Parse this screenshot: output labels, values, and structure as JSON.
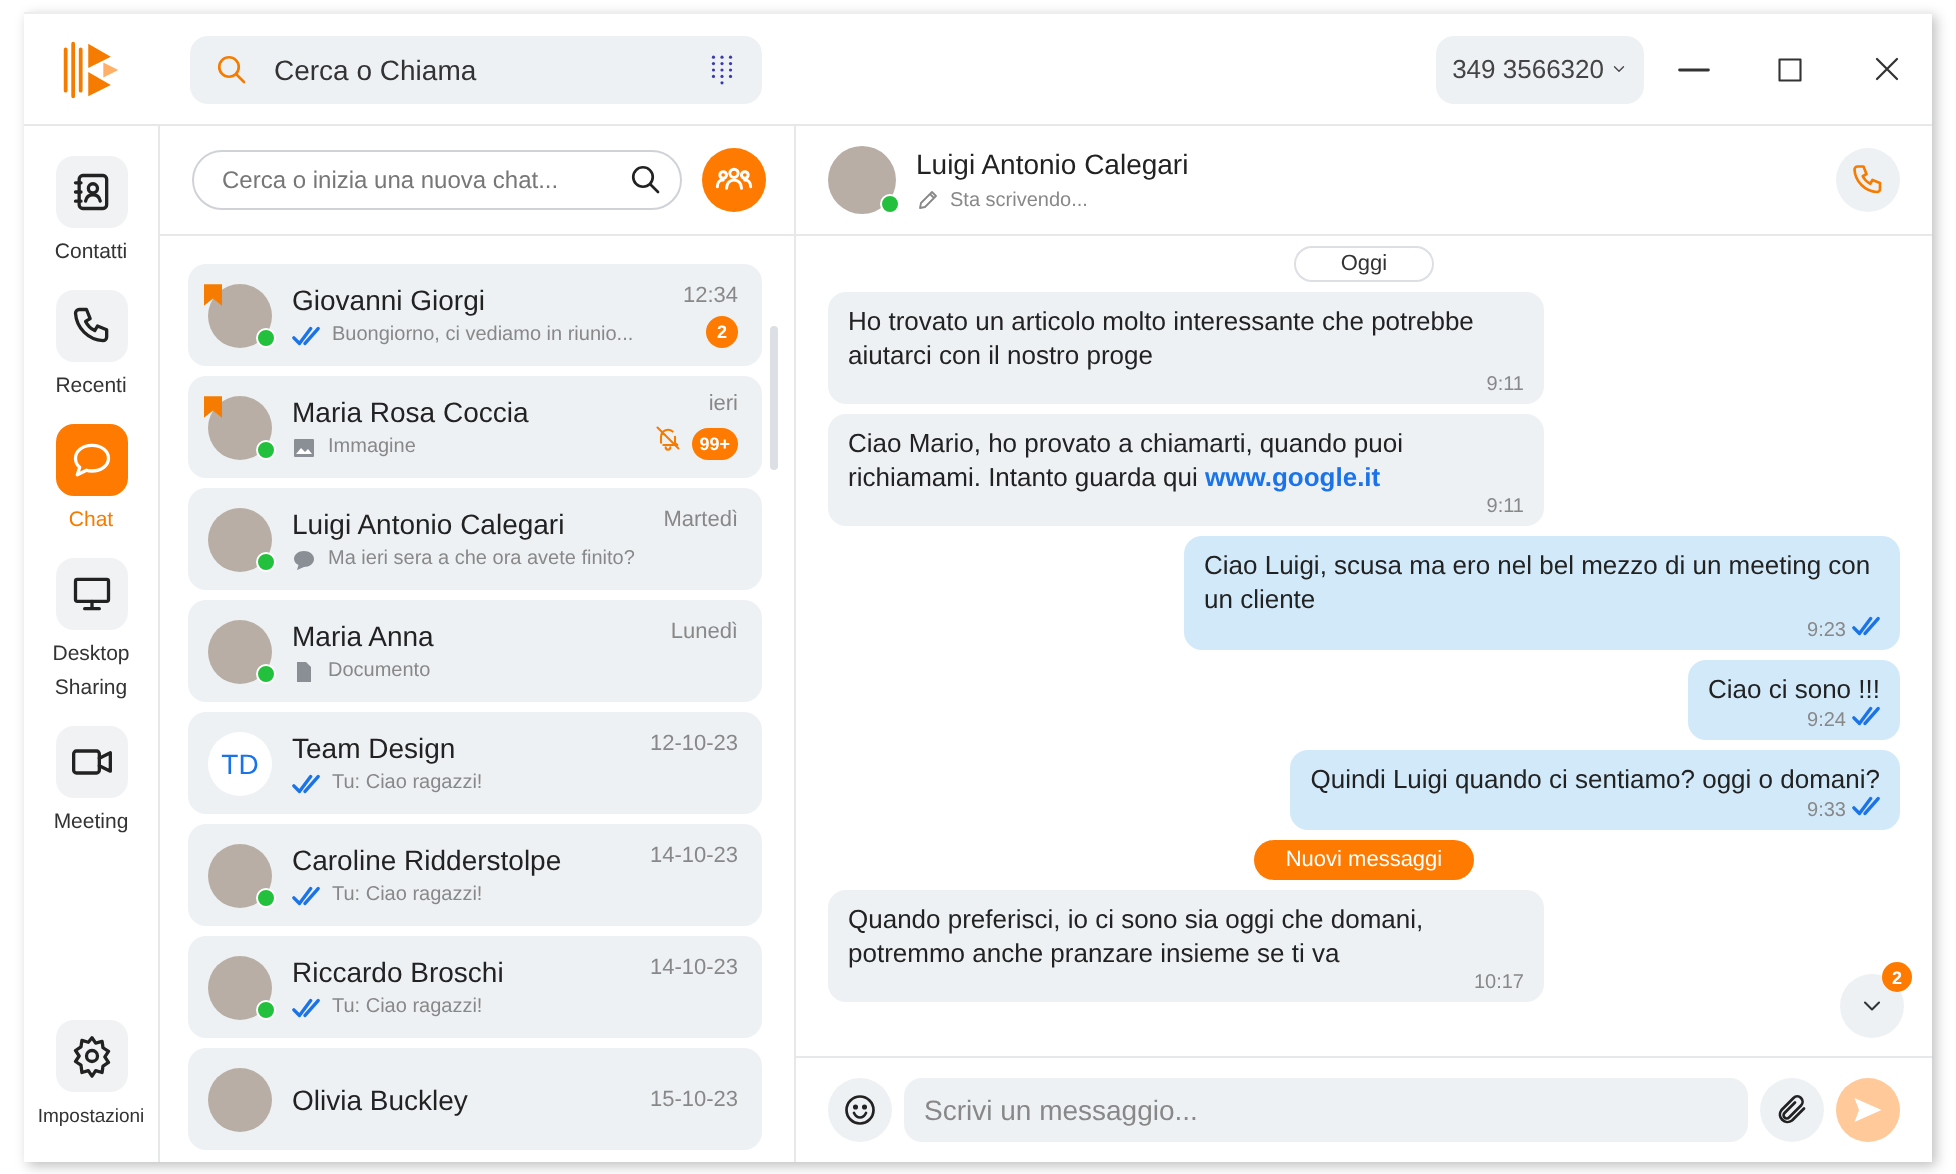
{
  "header": {
    "search_placeholder": "Cerca o Chiama",
    "phone_number": "349 3566320"
  },
  "nav": [
    {
      "kind": "contacts",
      "label": "Contatti",
      "selected": false
    },
    {
      "kind": "recent",
      "label": "Recenti",
      "selected": false
    },
    {
      "kind": "chat",
      "label": "Chat",
      "selected": true
    },
    {
      "kind": "screen",
      "label": "Desktop Sharing",
      "selected": false
    },
    {
      "kind": "meeting",
      "label": "Meeting",
      "selected": false
    }
  ],
  "settings": {
    "label": "Impostazioni"
  },
  "chat_list": {
    "search_placeholder": "Cerca o inizia una nuova chat...",
    "chats": [
      {
        "name": "Giovanni Giorgi",
        "time": "12:34",
        "preview": {
          "kind": "read",
          "text": "Buongiorno, ci vediamo in riunio..."
        },
        "pinned": true,
        "online": true,
        "unread": "2",
        "muted": false
      },
      {
        "name": "Maria Rosa Coccia",
        "time": "ieri",
        "preview": {
          "kind": "image",
          "text": "Immagine"
        },
        "pinned": true,
        "online": true,
        "unread": "99+",
        "muted": true
      },
      {
        "name": "Luigi Antonio Calegari",
        "time": "Martedì",
        "preview": {
          "kind": "message",
          "text": "Ma ieri sera a che ora avete finito?"
        },
        "pinned": false,
        "online": true,
        "muted": false
      },
      {
        "name": "Maria Anna",
        "time": "Lunedì",
        "preview": {
          "kind": "document",
          "text": "Documento"
        },
        "pinned": false,
        "online": true,
        "muted": false
      },
      {
        "name": "Team Design",
        "time": "12-10-23",
        "preview": {
          "kind": "read",
          "text": "Tu: Ciao ragazzi!"
        },
        "initials": "TD",
        "pinned": false,
        "online": false,
        "muted": false
      },
      {
        "name": "Caroline Ridderstolpe",
        "time": "14-10-23",
        "preview": {
          "kind": "read",
          "text": "Tu: Ciao ragazzi!"
        },
        "pinned": false,
        "online": true,
        "muted": false
      },
      {
        "name": "Riccardo Broschi",
        "time": "14-10-23",
        "preview": {
          "kind": "read",
          "text": "Tu: Ciao ragazzi!"
        },
        "pinned": false,
        "online": true,
        "muted": false
      },
      {
        "name": "Olivia Buckley",
        "time": "15-10-23",
        "pinned": false
      }
    ]
  },
  "conversation": {
    "name": "Luigi Antonio Calegari",
    "status": "Sta scrivendo...",
    "online": true,
    "messages": [
      {
        "kind": "date",
        "text": "Oggi"
      },
      {
        "kind": "incoming",
        "text": "Ho trovato un articolo molto interessante che potrebbe aiutarci con il nostro proge",
        "time": "9:11"
      },
      {
        "kind": "incoming",
        "text": "Ciao Mario, ho provato a chiamarti, quando puoi richiamami. Intanto guarda qui",
        "link": "www.google.it",
        "time": "9:11"
      },
      {
        "kind": "outgoing",
        "text": "Ciao Luigi, scusa ma ero nel bel mezzo di un meeting con un cliente",
        "time": "9:23",
        "read": true
      },
      {
        "kind": "outgoing",
        "text": "Ciao ci sono !!!",
        "time": "9:24",
        "read": true
      },
      {
        "kind": "outgoing",
        "text": "Quindi Luigi quando ci sentiamo? oggi o domani?",
        "time": "9:33",
        "read": true
      },
      {
        "kind": "new",
        "text": "Nuovi messaggi"
      },
      {
        "kind": "incoming",
        "text": "Quando preferisci, io ci sono sia oggi che domani, potremmo anche pranzare insieme se ti va",
        "time": "10:17"
      }
    ],
    "scroll_badge": "2",
    "composer_placeholder": "Scrivi un messaggio..."
  }
}
